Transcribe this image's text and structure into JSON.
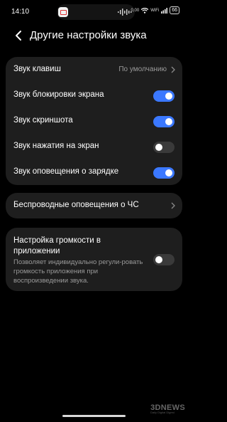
{
  "status_bar": {
    "time": "14:10",
    "network_speed": "0,00",
    "network_unit": "КБ/С",
    "battery": "66",
    "wifi_label": "WiFi"
  },
  "header": {
    "title": "Другие настройки звука"
  },
  "settings_card": {
    "key_sound": {
      "label": "Звук клавиш",
      "value": "По умолчанию"
    },
    "lock_sound": {
      "label": "Звук блокировки экрана",
      "enabled": true
    },
    "screenshot_sound": {
      "label": "Звук скриншота",
      "enabled": true
    },
    "touch_sound": {
      "label": "Звук нажатия на экран",
      "enabled": false
    },
    "charging_sound": {
      "label": "Звук оповещения о зарядке",
      "enabled": true
    }
  },
  "emergency": {
    "label": "Беспроводные оповещения о ЧС"
  },
  "app_volume": {
    "title": "Настройка громкости в приложении",
    "description": "Позволяет индивидуально регули-ровать громкость приложения при воспроизведении звука.",
    "enabled": false
  },
  "watermark": {
    "logo": "3DNEWS",
    "tagline": "Daily Digital Digest"
  },
  "colors": {
    "accent": "#3b78ff",
    "card": "#1e1e1e",
    "background": "#000000"
  }
}
